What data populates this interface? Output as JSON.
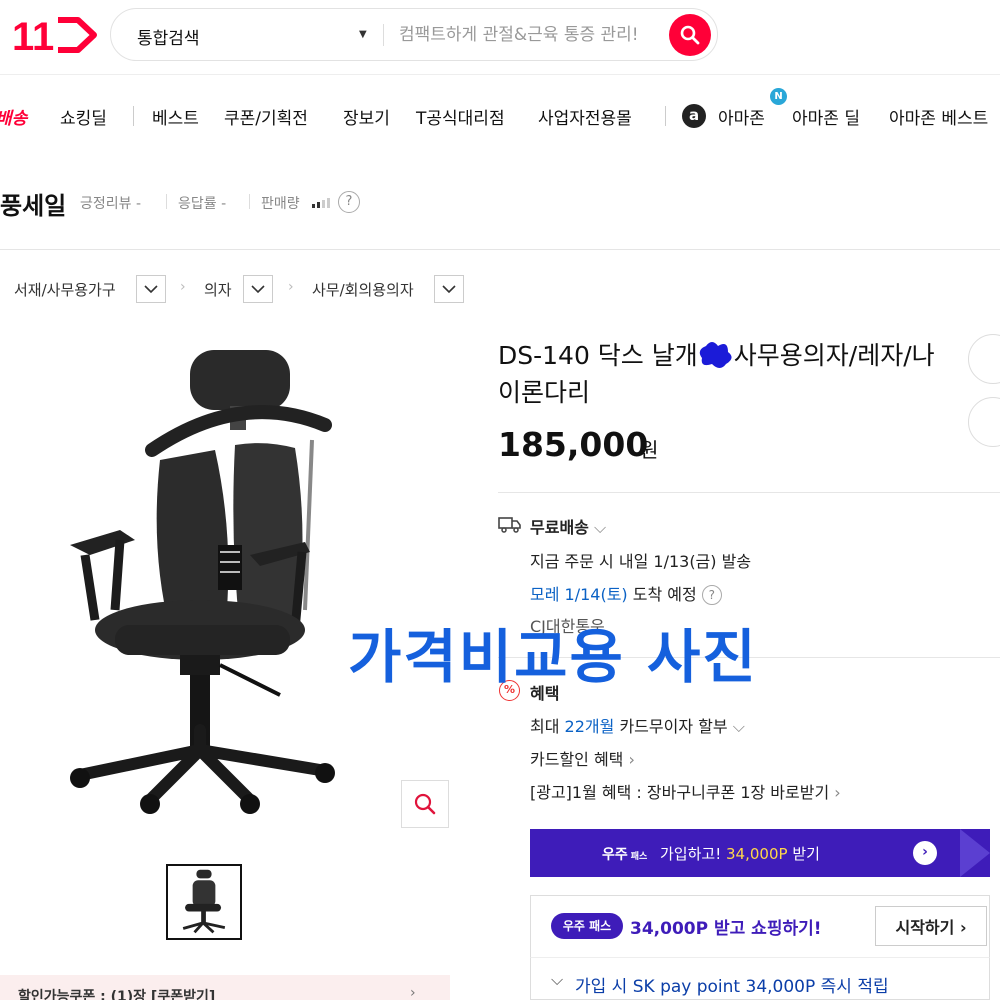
{
  "header": {
    "logo_text": "11",
    "search_scope": "통합검색",
    "search_placeholder": "컴팩트하게 관절&근육 통증 관리!",
    "brand_color": "#ff0038"
  },
  "nav": {
    "items": [
      {
        "label": "배송",
        "highlight": true
      },
      {
        "label": "쇼킹딜"
      },
      {
        "label": "베스트"
      },
      {
        "label": "쿠폰/기획전"
      },
      {
        "label": "장보기"
      },
      {
        "label": "T공식대리점"
      },
      {
        "label": "사업자전용몰"
      },
      {
        "label": "아마존"
      },
      {
        "label": "아마존 딜"
      },
      {
        "label": "아마존 베스트"
      }
    ],
    "amazon_icon_letter": "a",
    "new_badge": "N"
  },
  "seller": {
    "name": "풍세일",
    "review_label": "긍정리뷰 -",
    "response_label": "응답률 -",
    "sales_label": "판매량",
    "help": "?"
  },
  "breadcrumb": [
    "서재/사무용가구",
    "의자",
    "사무/회의용의자"
  ],
  "product": {
    "title_part1": "DS-140 닥스 날개",
    "title_part2": "사무용의자/레자/나이론다리",
    "price": "185,000",
    "currency": "원"
  },
  "shipping": {
    "label": "무료배송",
    "dispatch": "지금 주문 시 내일 1/13(금) 발송",
    "arrival_date": "모레 1/14(토)",
    "arrival_suffix": "도착 예정",
    "help": "?",
    "carrier": "CJ대한통운"
  },
  "benefits": {
    "label": "혜택",
    "icon": "%",
    "installment_prefix": "최대",
    "installment_months": "22개월",
    "installment_suffix": "카드무이자 할부",
    "card_discount": "카드할인 혜택",
    "ad": "[광고]1월 혜택 : 장바구니쿠폰 1장 바로받기"
  },
  "watermark": "가격비교용 사진",
  "promo": {
    "wooju_brand": "우주",
    "wooju_pass": "패스",
    "wooju_text": "가입하고!",
    "wooju_points": "34,000P",
    "wooju_suffix": "받기",
    "pass_pill": "우주 패스",
    "pass_text": "34,000P 받고 쇼핑하기!",
    "pass_button": "시작하기",
    "pass_sub": "가입 시 SK pay point 34,000P 즉시 적립",
    "purple": "#3e1cb9"
  },
  "coupon": {
    "text": "할인가능쿠폰 : (1)장 [쿠폰받기]"
  }
}
